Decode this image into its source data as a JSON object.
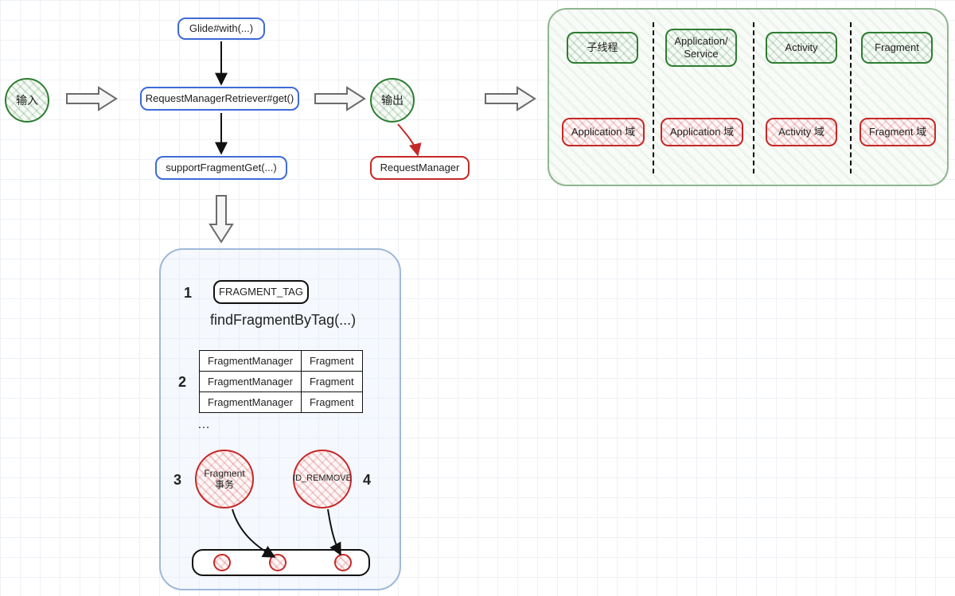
{
  "input_label": "输入",
  "output_label": "输出",
  "glide_with": "Glide#with(...)",
  "retriever_get": "RequestManagerRetriever#get()",
  "support_fragment_get": "supportFragmentGet(...)",
  "request_manager": "RequestManager",
  "green_panel": {
    "top": [
      "子线程",
      "Application/\nService",
      "Activity",
      "Fragment"
    ],
    "bottom": [
      "Application 域",
      "Application 域",
      "Activity 域",
      "Fragment 域"
    ]
  },
  "detail": {
    "step1_num": "1",
    "fragment_tag": "FRAGMENT_TAG",
    "find_by_tag": "findFragmentByTag(...)",
    "step2_num": "2",
    "table": [
      [
        "FragmentManager",
        "Fragment"
      ],
      [
        "FragmentManager",
        "Fragment"
      ],
      [
        "FragmentManager",
        "Fragment"
      ]
    ],
    "ellipsis": "…",
    "step3_num": "3",
    "fragment_tx": "Fragment\n事务",
    "step4_num": "4",
    "id_remove": "ID_REMMOVE"
  }
}
